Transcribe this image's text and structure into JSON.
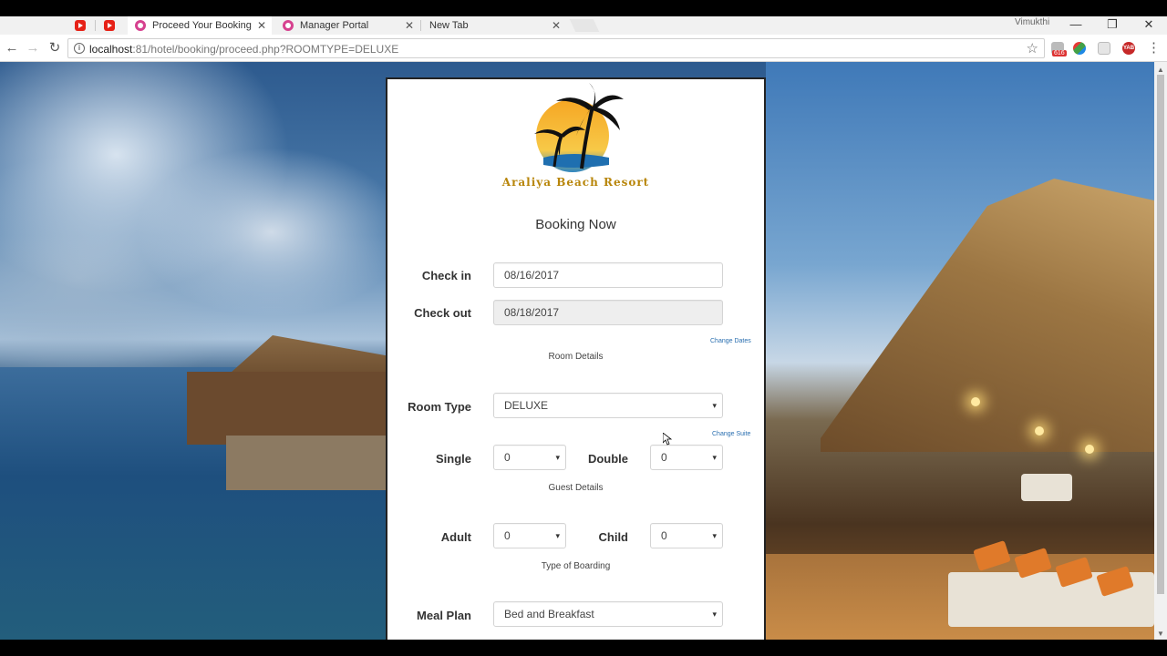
{
  "browser": {
    "tabs": [
      {
        "title": "",
        "icon": "youtube-icon"
      },
      {
        "title": "",
        "icon": "youtube-icon"
      },
      {
        "title": "Proceed Your Booking",
        "icon": "portal-icon",
        "active": true
      },
      {
        "title": "Manager Portal",
        "icon": "portal-icon"
      },
      {
        "title": "New Tab",
        "icon": ""
      }
    ],
    "profile": "Vimukthi",
    "url_host": "localhost",
    "url_rest": ":81/hotel/booking/proceed.php?ROOMTYPE=DELUXE",
    "mail_badge": "616",
    "ext_yab": "YAB"
  },
  "card": {
    "brand": "Araliya Beach Resort",
    "heading": "Booking Now",
    "checkin": {
      "label": "Check in",
      "value": "08/16/2017"
    },
    "checkout": {
      "label": "Check out",
      "value": "08/18/2017"
    },
    "change_dates": "Change Dates",
    "room_details": "Room Details",
    "room_type": {
      "label": "Room Type",
      "value": "DELUXE"
    },
    "change_suite": "Change Suite",
    "single": {
      "label": "Single",
      "value": "0"
    },
    "double": {
      "label": "Double",
      "value": "0"
    },
    "guest_details": "Guest Details",
    "adult": {
      "label": "Adult",
      "value": "0"
    },
    "child": {
      "label": "Child",
      "value": "0"
    },
    "type_of_boarding": "Type of Boarding",
    "meal_plan": {
      "label": "Meal Plan",
      "value": "Bed and Breakfast"
    }
  },
  "colors": {
    "brand_gold": "#b8860b",
    "link_blue": "#2a6fb0",
    "readonly_bg": "#eeeeee"
  }
}
